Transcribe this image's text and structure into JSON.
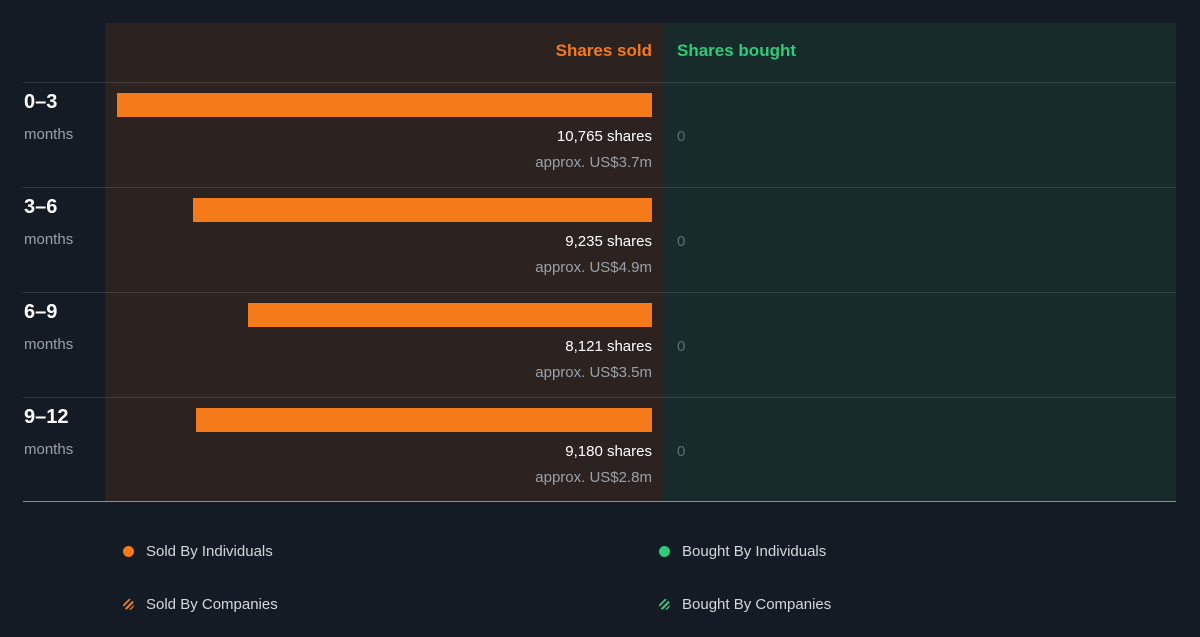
{
  "headers": {
    "sold": "Shares sold",
    "bought": "Shares bought"
  },
  "rows": [
    {
      "period": "0–3",
      "unit": "months",
      "shares_label": "10,765 shares",
      "approx": "approx. US$3.7m",
      "bought": "0"
    },
    {
      "period": "3–6",
      "unit": "months",
      "shares_label": "9,235 shares",
      "approx": "approx. US$4.9m",
      "bought": "0"
    },
    {
      "period": "6–9",
      "unit": "months",
      "shares_label": "8,121 shares",
      "approx": "approx. US$3.5m",
      "bought": "0"
    },
    {
      "period": "9–12",
      "unit": "months",
      "shares_label": "9,180 shares",
      "approx": "approx. US$2.8m",
      "bought": "0"
    }
  ],
  "legend": {
    "sold_individuals": "Sold By Individuals",
    "sold_companies": "Sold By Companies",
    "bought_individuals": "Bought By Individuals",
    "bought_companies": "Bought By Companies"
  },
  "colors": {
    "sold": "#f57b1a",
    "bought": "#2fcb79"
  },
  "chart_data": {
    "type": "bar",
    "categories": [
      "0–3 months",
      "3–6 months",
      "6–9 months",
      "9–12 months"
    ],
    "series": [
      {
        "name": "Shares sold",
        "values": [
          10765,
          9235,
          8121,
          9180
        ]
      },
      {
        "name": "Shares bought",
        "values": [
          0,
          0,
          0,
          0
        ]
      }
    ],
    "approx_value_usd_m": [
      3.7,
      4.9,
      3.5,
      2.8
    ],
    "legend": [
      "Sold By Individuals",
      "Sold By Companies",
      "Bought By Individuals",
      "Bought By Companies"
    ],
    "legend_position": "bottom"
  }
}
